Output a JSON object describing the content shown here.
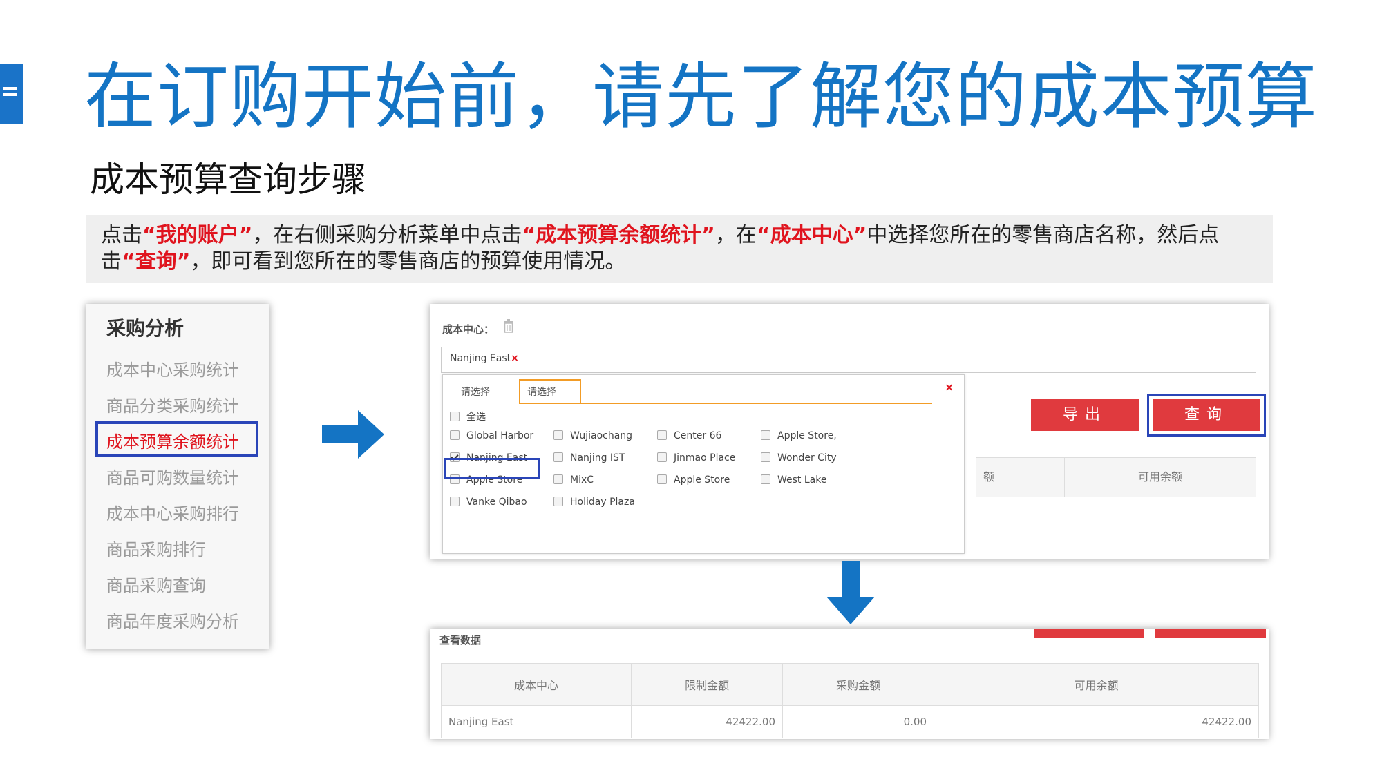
{
  "title": "在订购开始前，请先了解您的成本预算",
  "subtitle": "成本预算查询步骤",
  "instruction": {
    "t1": "点击",
    "q1": "“我的账户”",
    "t2": "，在右侧采购分析菜单中点击",
    "q2": "“成本预算余额统计”",
    "t3": "，在",
    "q3": "“成本中心”",
    "t4": "中选择您所在的零售商店名称，然后点击",
    "q4": "“查询”",
    "t5": "，即可看到您所在的零售商店的预算使用情况。"
  },
  "menu": {
    "header": "采购分析",
    "items": [
      {
        "label": "成本中心采购统计"
      },
      {
        "label": "商品分类采购统计"
      },
      {
        "label": "成本预算余额统计"
      },
      {
        "label": "商品可购数量统计"
      },
      {
        "label": "成本中心采购排行"
      },
      {
        "label": "商品采购排行"
      },
      {
        "label": "商品采购查询"
      },
      {
        "label": "商品年度采购分析"
      }
    ]
  },
  "query_panel": {
    "cost_center_label": "成本中心：",
    "selected_value": "Nanjing East",
    "remove_mark": "×",
    "export_label": "导出",
    "query_label": "查询",
    "partial_col1": "额",
    "partial_col2": "可用余额",
    "popup": {
      "tab1": "请选择",
      "tab2": "请选择",
      "close": "×",
      "select_all": "全选",
      "options": [
        {
          "label": "Global Harbor",
          "checked": false
        },
        {
          "label": "Wujiaochang",
          "checked": false
        },
        {
          "label": "Center 66",
          "checked": false
        },
        {
          "label": "Apple Store,",
          "checked": false
        },
        {
          "label": "Nanjing East",
          "checked": true
        },
        {
          "label": "Nanjing IST",
          "checked": false
        },
        {
          "label": "Jinmao Place",
          "checked": false
        },
        {
          "label": "Wonder City",
          "checked": false
        },
        {
          "label": "Apple Store",
          "checked": false
        },
        {
          "label": "MixC",
          "checked": false
        },
        {
          "label": "Apple Store",
          "checked": false
        },
        {
          "label": "West Lake",
          "checked": false
        },
        {
          "label": "Vanke Qibao",
          "checked": false
        },
        {
          "label": "Holiday Plaza",
          "checked": false
        }
      ]
    }
  },
  "result_panel": {
    "label": "查看数据",
    "headers": [
      "成本中心",
      "限制金额",
      "采购金额",
      "可用余额"
    ],
    "row": [
      "Nanjing East",
      "42422.00",
      "0.00",
      "42422.00"
    ]
  },
  "colors": {
    "title_blue": "#1474c4",
    "highlight_red": "#e0141e",
    "button_red": "#e03a3e",
    "selection_blue": "#2a45b8",
    "tab_orange": "#f29c26"
  }
}
